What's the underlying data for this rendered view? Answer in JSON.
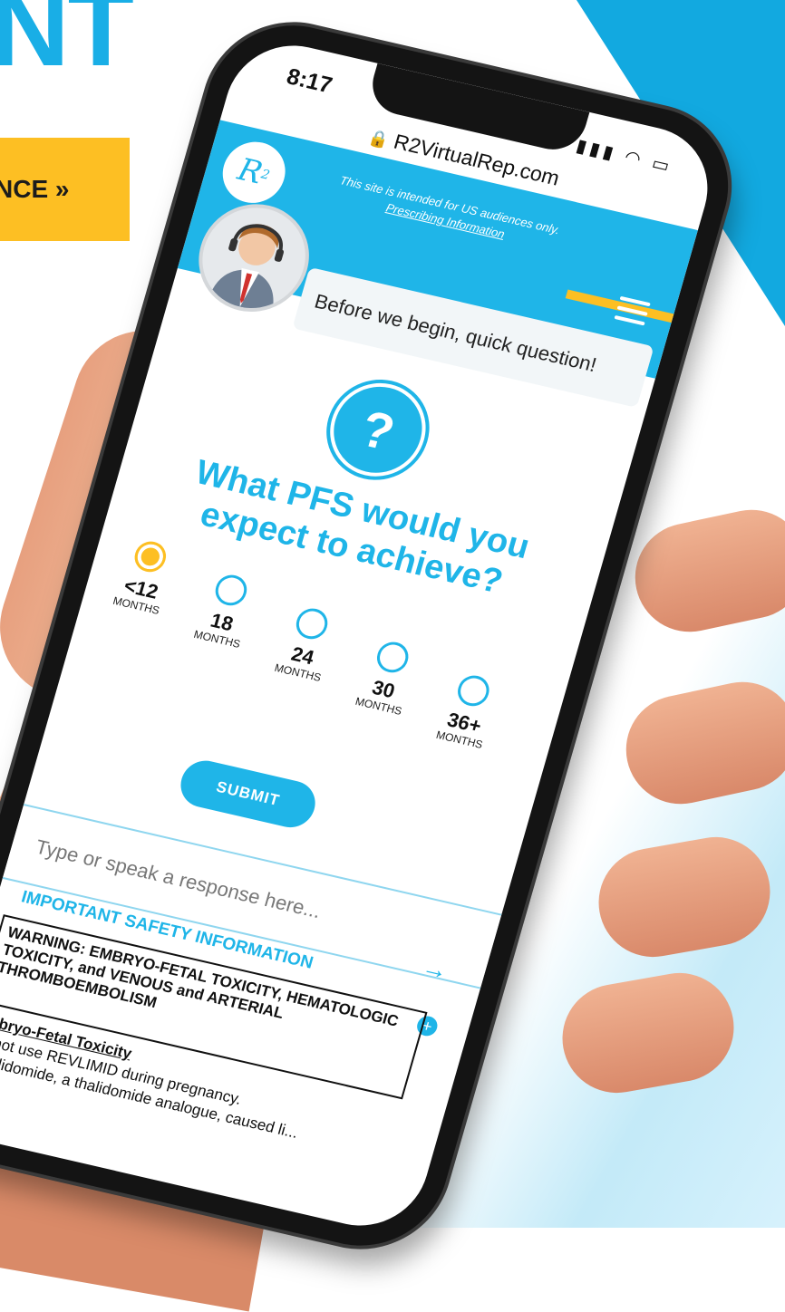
{
  "background": {
    "headline": "NT",
    "cta_label": "NCE »",
    "accent_blue": "#19aee6",
    "accent_yellow": "#fdbf23"
  },
  "status_bar": {
    "time": "8:17",
    "icons": [
      "signal-icon",
      "wifi-icon",
      "battery-icon"
    ]
  },
  "browser": {
    "url": "R2VirtualRep.com"
  },
  "site_header": {
    "logo": "R",
    "logo_sup": "2",
    "note": "This site is intended for US audiences only.",
    "prescribing_link": "Prescribing Information"
  },
  "chat": {
    "greeting": "Before we begin, quick question!"
  },
  "question": {
    "icon": "?",
    "text": "What PFS would you expect to achieve?",
    "options": [
      {
        "value": "<12",
        "unit": "MONTHS",
        "selected": true
      },
      {
        "value": "18",
        "unit": "MONTHS",
        "selected": false
      },
      {
        "value": "24",
        "unit": "MONTHS",
        "selected": false
      },
      {
        "value": "30",
        "unit": "MONTHS",
        "selected": false
      },
      {
        "value": "36+",
        "unit": "MONTHS",
        "selected": false
      }
    ],
    "submit_label": "SUBMIT"
  },
  "response_input": {
    "placeholder": "Type or speak a response here..."
  },
  "safety": {
    "header": "IMPORTANT SAFETY INFORMATION",
    "warning": "WARNING: EMBRYO-FETAL TOXICITY, HEMATOLOGIC TOXICITY, and VENOUS and ARTERIAL THROMBOEMBOLISM",
    "subheading": "Embryo-Fetal Toxicity",
    "body": "Do not use REVLIMID during pregnancy.",
    "body2": "Lenalidomide, a thalidomide analogue, caused li..."
  }
}
